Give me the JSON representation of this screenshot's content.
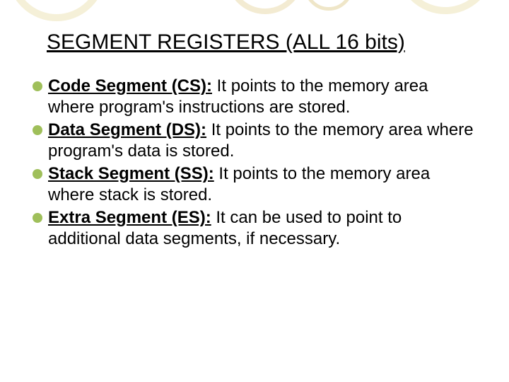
{
  "title": "SEGMENT REGISTERS (ALL 16 bits)",
  "bullets": [
    {
      "term": "Code Segment (CS):",
      "desc": " It points to the memory area where program's instructions are stored."
    },
    {
      "term": "Data Segment (DS):",
      "desc": " It points to the memory area where program's data is stored."
    },
    {
      "term": "Stack Segment (SS):",
      "desc": " It points to the memory area where stack is stored."
    },
    {
      "term": "Extra Segment (ES):",
      "desc": " It can be used to point to additional data segments, if necessary."
    }
  ],
  "colors": {
    "bullet": "#9fbf5a",
    "circleTint": "#f0e8cc"
  }
}
